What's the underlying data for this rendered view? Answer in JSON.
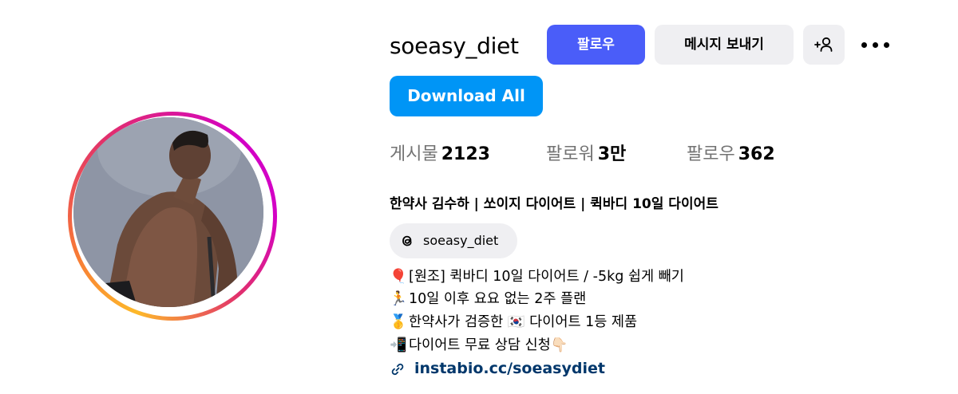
{
  "profile": {
    "username": "soeasy_diet",
    "full_name": "한약사 김수하 | 쏘이지 다이어트 | 퀵바디 10일 다이어트"
  },
  "actions": {
    "follow_label": "팔로우",
    "message_label": "메시지 보내기",
    "add_user_icon": "add-user-icon",
    "more_icon": "more-icon",
    "download_all_label": "Download All"
  },
  "stats": {
    "posts_label": "게시물",
    "posts_value": "2123",
    "followers_label": "팔로워",
    "followers_value": "3만",
    "following_label": "팔로우",
    "following_value": "362"
  },
  "threads": {
    "icon": "threads-icon",
    "handle": "soeasy_diet"
  },
  "bio": {
    "lines": [
      {
        "emoji": "🎈",
        "text": "[원조] 퀵바디 10일 다이어트 / -5kg 쉽게 빼기"
      },
      {
        "emoji": "🏃",
        "text": "10일 이후 요요 없는 2주 플랜"
      },
      {
        "emoji": "🥇",
        "text": "한약사가 검증한 🇰🇷 다이어트 1등 제품"
      },
      {
        "emoji": "📲",
        "text": "다이어트 무료 상담 신청👇🏻"
      }
    ]
  },
  "link": {
    "icon": "link-icon",
    "url_text": "instabio.cc/soeasydiet"
  },
  "colors": {
    "follow_button": "#4a5df9",
    "download_button": "#0095f6",
    "secondary_button": "#efeff2",
    "link_text": "#00376b",
    "muted_text": "#737373"
  }
}
